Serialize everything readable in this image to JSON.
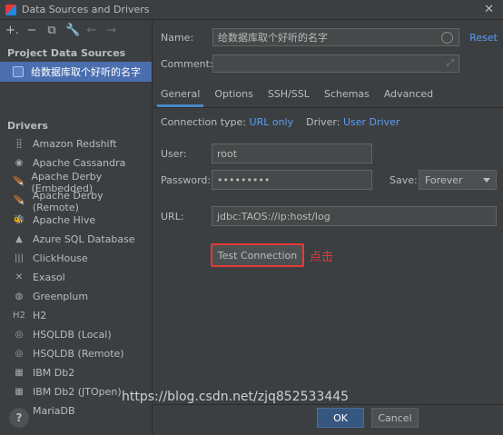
{
  "window": {
    "title": "Data Sources and Drivers"
  },
  "toolbar": {
    "add": "+.",
    "remove": "−",
    "copy": "⧉",
    "settings": "🔧",
    "back": "←",
    "forward": "→"
  },
  "left": {
    "project_title": "Project Data Sources",
    "data_source": "给数据库取个好听的名字",
    "drivers_title": "Drivers",
    "drivers": [
      "Amazon Redshift",
      "Apache Cassandra",
      "Apache Derby (Embedded)",
      "Apache Derby (Remote)",
      "Apache Hive",
      "Azure SQL Database",
      "ClickHouse",
      "Exasol",
      "Greenplum",
      "H2",
      "HSQLDB (Local)",
      "HSQLDB (Remote)",
      "IBM Db2",
      "IBM Db2 (JTOpen)",
      "MariaDB"
    ],
    "help": "?"
  },
  "form": {
    "name_label": "Name:",
    "name_value": "给数据库取个好听的名字",
    "reset": "Reset",
    "comment_label": "Comment:",
    "comment_value": "",
    "tabs": [
      "General",
      "Options",
      "SSH/SSL",
      "Schemas",
      "Advanced"
    ],
    "conn_type_label": "Connection type:",
    "conn_type_value": "URL only",
    "driver_label": "Driver:",
    "driver_value": "User Driver",
    "user_label": "User:",
    "user_value": "root",
    "password_label": "Password:",
    "password_value": "•••••••••",
    "save_label": "Save:",
    "save_value": "Forever",
    "url_label": "URL:",
    "url_value": "jdbc:TAOS://ip:host/log",
    "test_button": "Test Connection",
    "annotation": "点击"
  },
  "footer": {
    "ok": "OK",
    "cancel": "Cancel",
    "watermark": "https://blog.csdn.net/zjq852533445"
  },
  "colors": {
    "accent": "#4a88c7",
    "selection": "#4b6eaf",
    "highlight": "#e53935",
    "link": "#589df6"
  }
}
